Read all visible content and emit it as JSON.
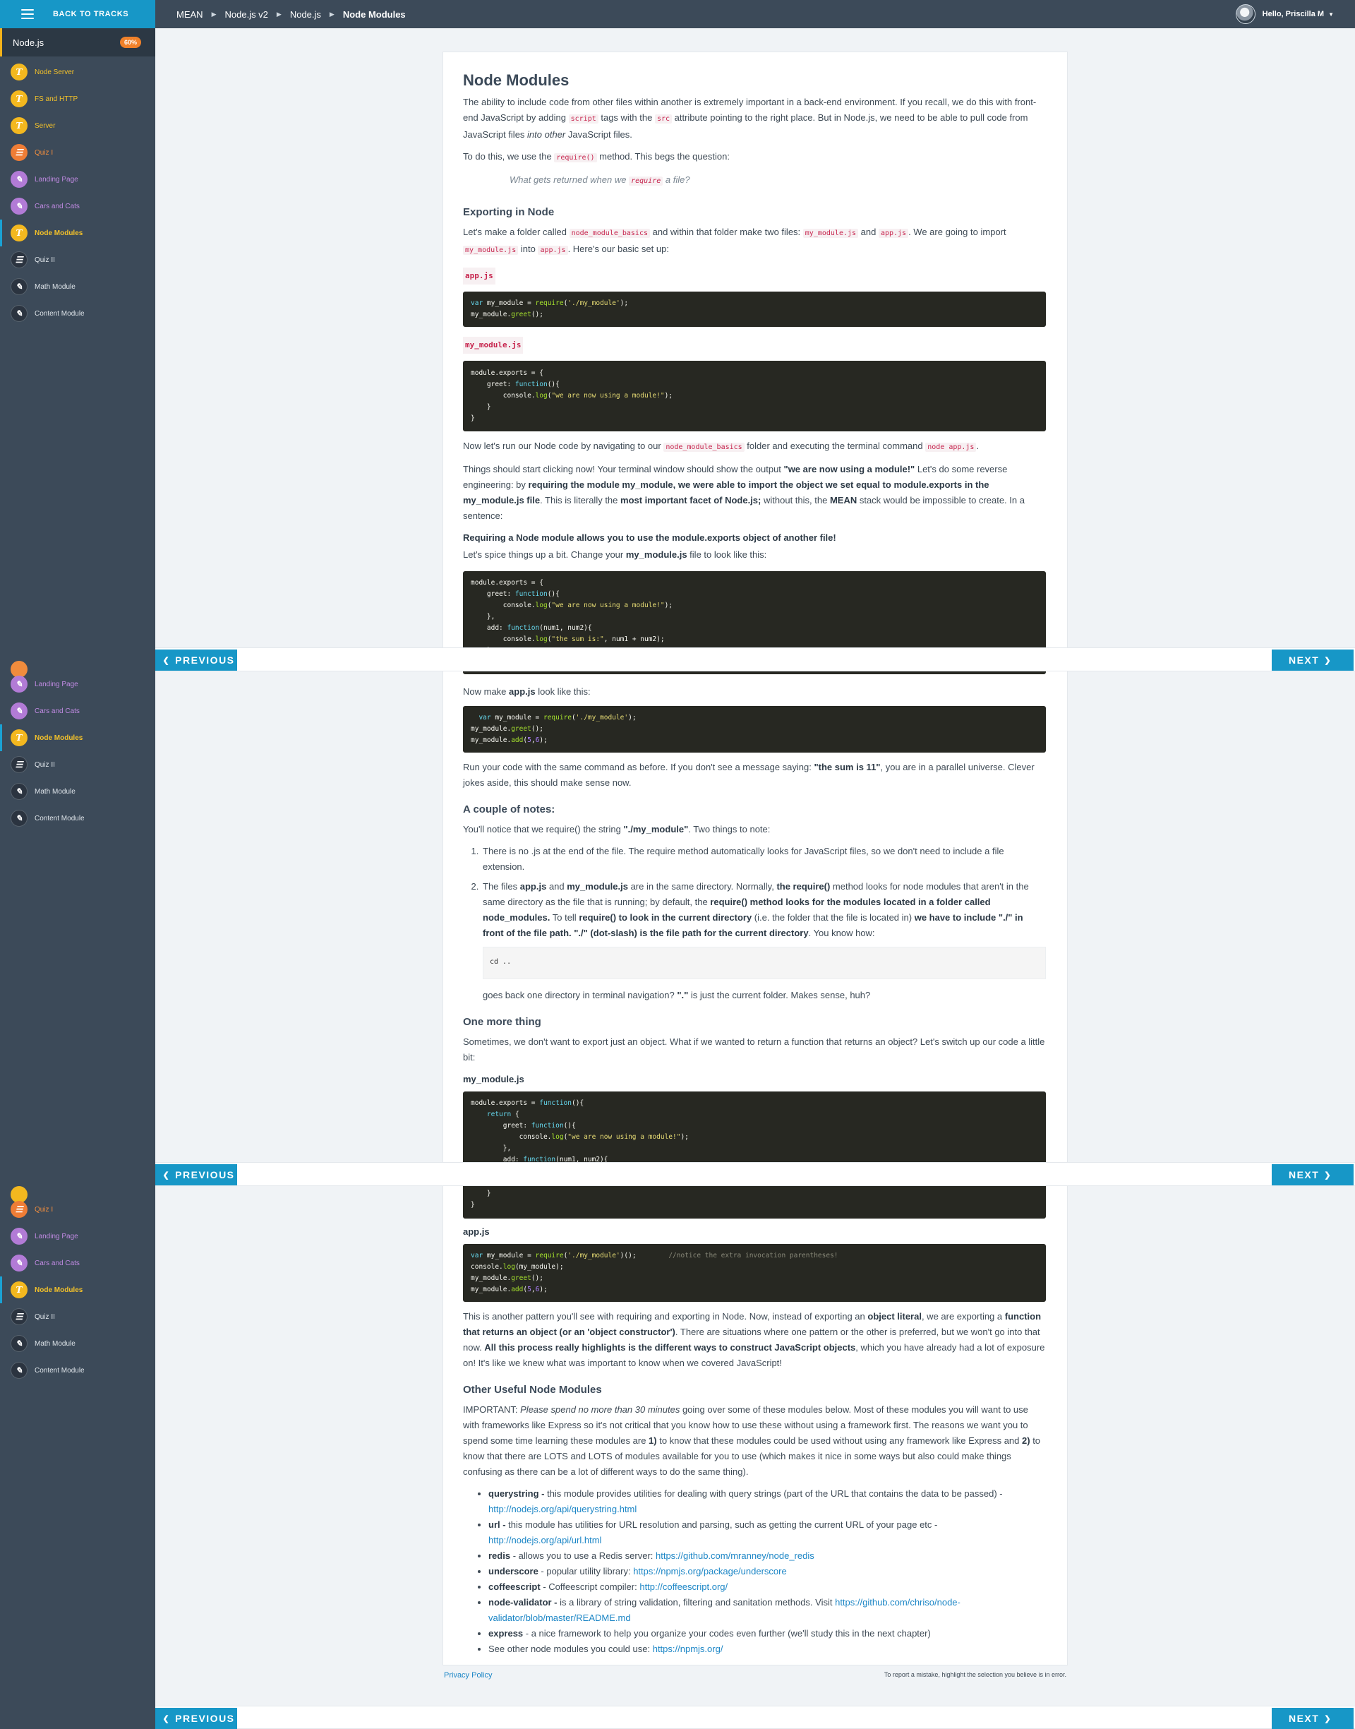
{
  "topbar": {
    "back_label": "BACK TO TRACKS",
    "breadcrumbs": [
      "MEAN",
      "Node.js v2",
      "Node.js",
      "Node Modules"
    ],
    "user_greeting": "Hello, Priscilla M"
  },
  "sidebar": {
    "track_name": "Node.js",
    "progress": "60%",
    "items": [
      {
        "label": "Node Server",
        "icon": "T"
      },
      {
        "label": "FS and HTTP",
        "icon": "T"
      },
      {
        "label": "Server",
        "icon": "T"
      },
      {
        "label": "Quiz I",
        "icon": "quiz"
      },
      {
        "label": "Landing Page",
        "icon": "pencil"
      },
      {
        "label": "Cars and Cats",
        "icon": "pencil"
      },
      {
        "label": "Node Modules",
        "icon": "T"
      },
      {
        "label": "Quiz II",
        "icon": "quiz"
      },
      {
        "label": "Math Module",
        "icon": "pencil"
      },
      {
        "label": "Content Module",
        "icon": "pencil"
      }
    ]
  },
  "nav": {
    "previous": "PREVIOUS",
    "next": "NEXT"
  },
  "content": {
    "title": "Node Modules",
    "p1a": "The ability to include code from other files within another is extremely important in a back-end environment. If you recall, we do this with front-end JavaScript by adding ",
    "p1_code1": "script",
    "p1b": " tags with the ",
    "p1_code2": "src",
    "p1c": " attribute pointing to the right place. But in Node.js, we need to be able to pull code from JavaScript files ",
    "p1_em": "into other",
    "p1d": " JavaScript files.",
    "p2a": "To do this, we use the ",
    "p2_code": "require()",
    "p2b": " method. This begs the question:",
    "quote_a": "What gets returned when we ",
    "quote_code": "require",
    "quote_b": " a file?",
    "h_exporting": "Exporting in Node",
    "p3a": "Let's make a folder called ",
    "p3_code1": "node_module_basics",
    "p3b": " and within that folder make two files: ",
    "p3_code2": "my_module.js",
    "p3c": " and ",
    "p3_code3": "app.js",
    "p3d": ". We are going to import ",
    "p3_code4": "my_module.js",
    "p3e": " into ",
    "p3_code5": "app.js",
    "p3f": ". Here's our basic set up:",
    "label_appjs": "app.js",
    "label_mymodule": "my_module.js",
    "p4a": "Now let's run our Node code by navigating to our ",
    "p4_code1": "node_module_basics",
    "p4b": " folder and executing the terminal command ",
    "p4_code2": "node app.js",
    "p4c": ".",
    "p5a": "Things should start clicking now! Your terminal window should show the output ",
    "p5_b1": "\"we are now using a module!\"",
    "p5b": " Let's do some reverse engineering: by ",
    "p5_b2": "requiring the module my_module, we were able to import the object we set equal to module.exports in the my_module.js file",
    "p5c": ". This is literally the ",
    "p5_b3": "most important facet of Node.js;",
    "p5d": " without this, the ",
    "p5_b4": "MEAN",
    "p5e": " stack would be impossible to create. In a sentence:",
    "p6": "Requiring a Node module allows you to use the module.exports object of another file!",
    "p7a": "Let's spice things up a bit. Change your ",
    "p7_b": "my_module.js",
    "p7b": " file to look like this:",
    "p8a": "Now make ",
    "p8_b": "app.js",
    "p8b": " look like this:",
    "p9a": "Run your code with the same command as before. If you don't see a message saying: ",
    "p9_b": "\"the sum is 11\"",
    "p9b": ", you are in a parallel universe. Clever jokes aside, this should make sense now.",
    "h_notes": "A couple of notes:",
    "p10a": "You'll notice that we require() the string ",
    "p10_b": "\"./my_module\"",
    "p10b": ". Two things to note:",
    "li1": "There is no .js at the end of the file. The require method automatically looks for JavaScript files, so we don't need to include a file extension.",
    "li2a": "The files ",
    "li2_b1": "app.js",
    "li2b": " and ",
    "li2_b2": "my_module.js",
    "li2c": " are in the same directory. Normally, ",
    "li2_b3": "the require()",
    "li2d": " method looks for node modules that aren't in the same directory as the file that is running; by default, the ",
    "li2_b4": "require() method looks for the modules located in a folder called node_modules.",
    "li2e": " To tell ",
    "li2_b5": "require() to look in the current directory",
    "li2f": " (i.e. the folder that the file is located in) ",
    "li2_b6": "we have to include \"./\" in front of the file path. \"./\" (dot-slash) is the file path for the current directory",
    "li2g": ". You know how:",
    "cd_code": "cd ..",
    "li2h": "goes back one directory in terminal navigation? ",
    "li2_b7": "\".\"",
    "li2i": " is just the current folder. Makes sense, huh?",
    "h_onemore": "One more thing",
    "p11": "Sometimes, we don't want to export just an object. What if we wanted to return a function that returns an object? Let's switch up our code a little bit:",
    "label_mymodule2": "my_module.js",
    "label_appjs2": "app.js",
    "code_comment": "//notice the extra invocation parentheses!",
    "p12a": "This is another pattern you'll see with requiring and exporting in Node. Now, instead of exporting an ",
    "p12_b1": "object literal",
    "p12b": ", we are exporting a ",
    "p12_b2": "function that returns an object (or an 'object constructor')",
    "p12c": ". There are situations where one pattern or the other is preferred, but we won't go into that now. ",
    "p12_b3": "All this process really highlights is the different ways to construct JavaScript objects",
    "p12d": ", which you have already had a lot of exposure on! It's like we knew what was important to know when we covered JavaScript!",
    "h_other": "Other Useful Node Modules",
    "p13a": "IMPORTANT: ",
    "p13_em": "Please spend no more than 30 minutes",
    "p13b": " going over some of these modules below. Most of these modules you will want to use with frameworks like Express so it's not critical that you know how to use these without using a framework first. The reasons we want you to spend some time learning these modules are ",
    "p13_b1": "1)",
    "p13c": " to know that these modules could be used without using any framework like Express and ",
    "p13_b2": "2)",
    "p13d": " to know that there are LOTS and LOTS of modules available for you to use (which makes it nice in some ways but also could make things confusing as there can be a lot of different ways to do the same thing).",
    "modules": [
      {
        "name": "querystring -",
        "desc": " this module provides utilities for dealing with query strings (part of the URL that contains the data to be passed) - ",
        "link": "http://nodejs.org/api/querystring.html"
      },
      {
        "name": "url -",
        "desc": " this module has utilities for URL resolution and parsing, such as getting the current URL of your page etc - ",
        "link": "http://nodejs.org/api/url.html"
      },
      {
        "name": "redis",
        "desc": " - allows you to use a Redis server: ",
        "link": "https://github.com/mranney/node_redis"
      },
      {
        "name": "underscore",
        "desc": " - popular utility library: ",
        "link": "https://npmjs.org/package/underscore"
      },
      {
        "name": "coffeescript",
        "desc": " - Coffeescript compiler: ",
        "link": "http://coffeescript.org/"
      },
      {
        "name": "node-validator -",
        "desc": " is a library of string validation, filtering and sanitation methods. Visit ",
        "link": "https://github.com/chriso/node-validator/blob/master/README.md"
      },
      {
        "name": "express",
        "desc": " - a nice framework to help you organize your codes even further (we'll study this in the next chapter)",
        "link": ""
      },
      {
        "name": "",
        "desc": "See other node modules you could use: ",
        "link": "https://npmjs.org/"
      }
    ]
  },
  "footer": {
    "privacy": "Privacy Policy",
    "note": "To report a mistake, highlight the selection you believe is in error."
  },
  "colors": {
    "accent": "#1797c7",
    "topbar": "#3c4a59",
    "code_bg": "#272822"
  }
}
